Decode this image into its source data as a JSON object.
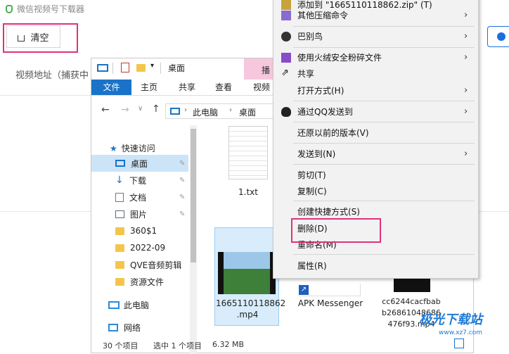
{
  "app": {
    "title": "微信视频号下载器",
    "clear_label": "清空",
    "video_label": "视频地址（捕获中"
  },
  "explorer": {
    "title": "桌面",
    "tabs": [
      "文件",
      "主页",
      "共享",
      "查看",
      "视频"
    ],
    "play_tab": "播",
    "breadcrumb": [
      "此电脑",
      "桌面"
    ],
    "quick_access": "快速访问",
    "nav_items": [
      {
        "label": "桌面",
        "icon": "desktop-icon"
      },
      {
        "label": "下载",
        "icon": "download-icon"
      },
      {
        "label": "文档",
        "icon": "document-icon"
      },
      {
        "label": "图片",
        "icon": "picture-icon"
      },
      {
        "label": "360$1",
        "icon": "folder-icon"
      },
      {
        "label": "2022-09",
        "icon": "folder-icon"
      },
      {
        "label": "QVE音频剪辑",
        "icon": "folder-icon"
      },
      {
        "label": "资源文件",
        "icon": "folder-icon"
      }
    ],
    "this_pc": "此电脑",
    "network": "网络",
    "files": [
      {
        "name": "1.txt"
      },
      {
        "name": "1665110118862\n.mp4"
      },
      {
        "name": "APK Messenger"
      },
      {
        "name": "cc6244cacfbab\nb26861048686\n476f93.mp4"
      }
    ],
    "status": {
      "count": "30 个项目",
      "selected": "选中 1 个项目",
      "size": "6.32 MB"
    }
  },
  "context_menu": {
    "items": [
      {
        "label": "添加到 \"1665110118862.zip\" (T)",
        "icon": "archive-icon",
        "submenu": false
      },
      {
        "label": "其他压缩命令",
        "icon": "archive-icon",
        "submenu": true
      },
      {
        "label": "巴别鸟",
        "icon": "bird-icon",
        "submenu": true
      },
      {
        "label": "使用火绒安全粉碎文件",
        "icon": "shred-icon",
        "submenu": true
      },
      {
        "label": "共享",
        "icon": "share-icon",
        "submenu": false
      },
      {
        "label": "打开方式(H)",
        "icon": "",
        "submenu": true
      },
      {
        "label": "通过QQ发送到",
        "icon": "qq-icon",
        "submenu": true
      },
      {
        "label": "还原以前的版本(V)",
        "icon": "",
        "submenu": false
      },
      {
        "label": "发送到(N)",
        "icon": "",
        "submenu": true
      },
      {
        "label": "剪切(T)",
        "icon": "",
        "submenu": false
      },
      {
        "label": "复制(C)",
        "icon": "",
        "submenu": false
      },
      {
        "label": "创建快捷方式(S)",
        "icon": "",
        "submenu": false
      },
      {
        "label": "删除(D)",
        "icon": "",
        "submenu": false
      },
      {
        "label": "重命名(M)",
        "icon": "",
        "submenu": false
      },
      {
        "label": "属性(R)",
        "icon": "",
        "submenu": false
      }
    ]
  },
  "watermark": {
    "text": "极光下载站",
    "url": "www.xz7.com"
  },
  "colors": {
    "highlight": "#e0327a",
    "accent": "#1a73c8",
    "selection": "#cce4f7"
  }
}
